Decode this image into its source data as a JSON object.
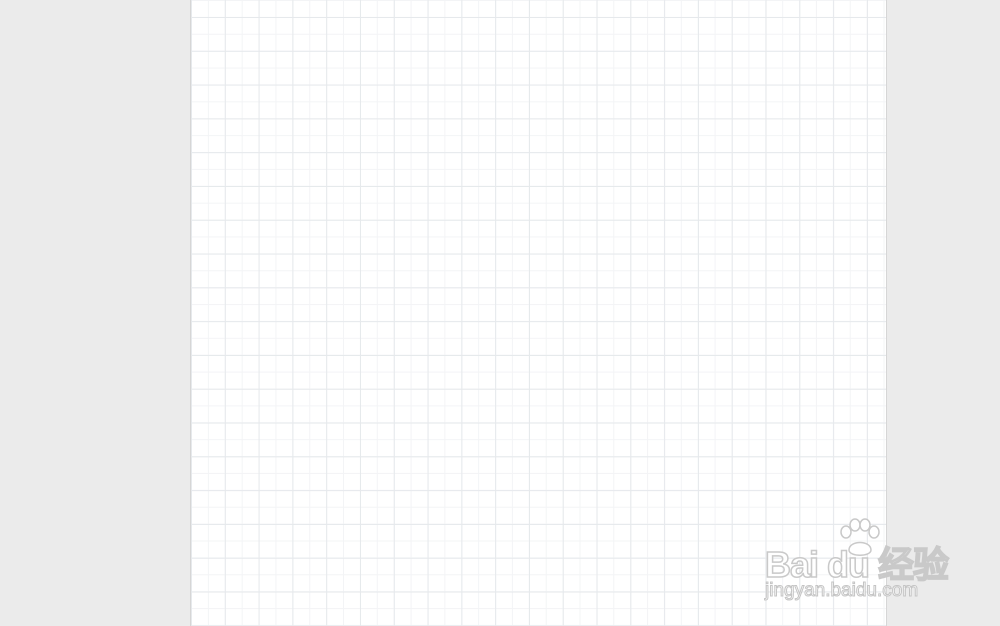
{
  "workspace": {
    "background_color": "#ebebeb"
  },
  "page": {
    "background_color": "#ffffff",
    "grid_color": "#e6e9ec",
    "style": "grid-paper"
  },
  "watermark": {
    "logo_text": "Bai du 经验",
    "url_text": "jingyan.baidu.com",
    "icon": "paw-icon"
  }
}
